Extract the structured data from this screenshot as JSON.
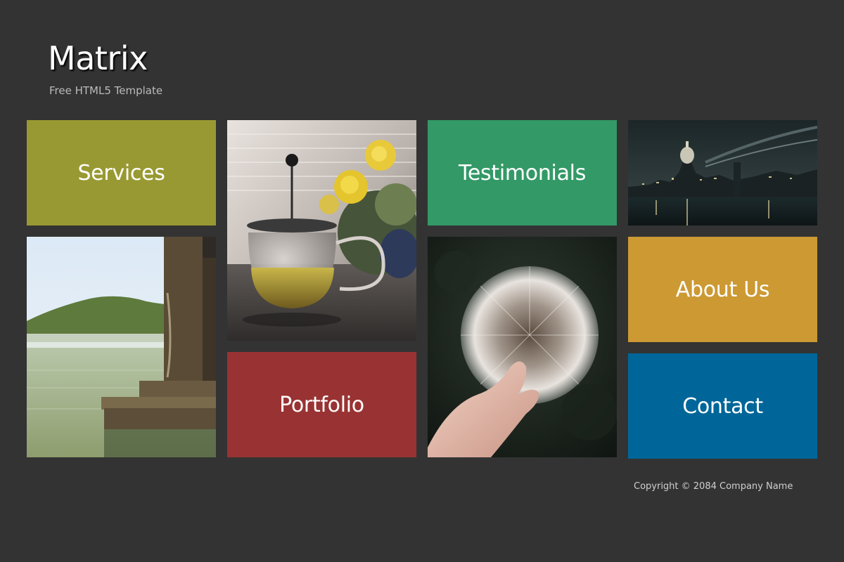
{
  "header": {
    "title": "Matrix",
    "tagline": "Free HTML5 Template"
  },
  "tiles": {
    "services": {
      "label": "Services",
      "color": "#999933"
    },
    "testimonials": {
      "label": "Testimonials",
      "color": "#339966"
    },
    "portfolio": {
      "label": "Portfolio",
      "color": "#993333"
    },
    "about": {
      "label": "About Us",
      "color": "#cc9933"
    },
    "contact": {
      "label": "Contact",
      "color": "#006699"
    }
  },
  "photos": {
    "lake": "lake-dock-photo",
    "teapot": "tea-press-flowers-photo",
    "city": "city-night-photo",
    "dandelion": "dandelion-hand-photo"
  },
  "footer": {
    "copyright": "Copyright © 2084 Company Name"
  }
}
